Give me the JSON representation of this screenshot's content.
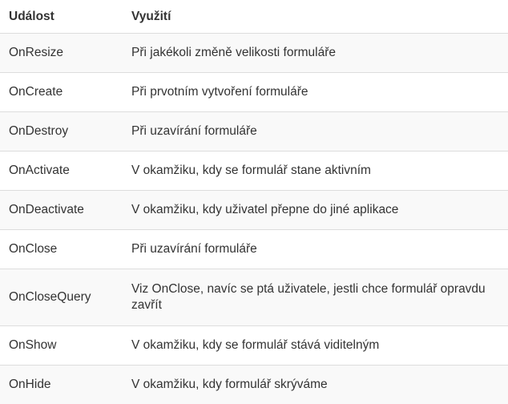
{
  "table": {
    "headers": [
      "Událost",
      "Využití"
    ],
    "rows": [
      [
        "OnResize",
        "Při jakékoli změně velikosti formuláře"
      ],
      [
        "OnCreate",
        "Při prvotním vytvoření formuláře"
      ],
      [
        "OnDestroy",
        "Při uzavírání formuláře"
      ],
      [
        "OnActivate",
        "V okamžiku, kdy se formulář stane aktivním"
      ],
      [
        "OnDeactivate",
        "V okamžiku, kdy uživatel přepne do jiné aplikace"
      ],
      [
        "OnClose",
        "Při uzavírání formuláře"
      ],
      [
        "OnCloseQuery",
        "Viz OnClose, navíc se ptá uživatele, jestli chce formulář opravdu zavřít"
      ],
      [
        "OnShow",
        "V okamžiku, kdy se formulář stává viditelným"
      ],
      [
        "OnHide",
        "V okamžiku, kdy formulář skrýváme"
      ]
    ]
  }
}
